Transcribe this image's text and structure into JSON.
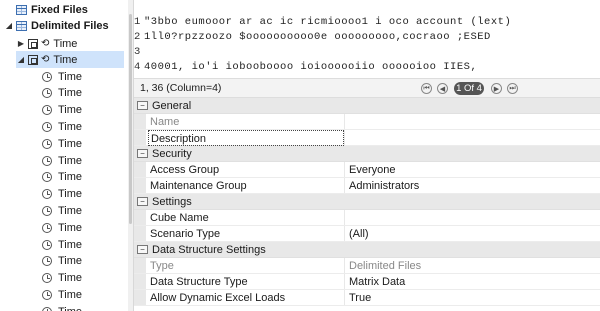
{
  "tree": {
    "items": [
      {
        "label": "Fixed Files",
        "kind": "table"
      },
      {
        "label": "Delimited Files",
        "kind": "table"
      },
      {
        "label": "Time",
        "kind": "dim"
      },
      {
        "label": "Time",
        "kind": "dim"
      },
      {
        "label": "Time"
      },
      {
        "label": "Time"
      },
      {
        "label": "Time"
      },
      {
        "label": "Time"
      },
      {
        "label": "Time"
      },
      {
        "label": "Time"
      },
      {
        "label": "Time"
      },
      {
        "label": "Time"
      },
      {
        "label": "Time"
      },
      {
        "label": "Time"
      },
      {
        "label": "Time"
      },
      {
        "label": "Time"
      },
      {
        "label": "Time"
      },
      {
        "label": "Time"
      },
      {
        "label": "Time"
      }
    ]
  },
  "grid": {
    "lines": [
      {
        "num": "1",
        "text": "\"3bbo eumooor ar ac ic ricmioooo1 i oco account (lext)"
      },
      {
        "num": "2",
        "text": "1ll0?rpzzoozo  $oooooooooo0e ooooooooo,cocraoo ;ESED"
      },
      {
        "num": "3",
        "text": ""
      },
      {
        "num": "4",
        "text": "40001,  io'i iobooboooo  ioioooooiio oooooioo  IIES,"
      }
    ]
  },
  "nav": {
    "position": "1, 36  (Column=4)",
    "page": "1 Of 4"
  },
  "props": {
    "general": "General",
    "name_label": "Name",
    "name_value": "",
    "description_label": "Description",
    "description_value": "",
    "security": "Security",
    "access_group_label": "Access Group",
    "access_group_value": "Everyone",
    "maintenance_group_label": "Maintenance Group",
    "maintenance_group_value": "Administrators",
    "settings": "Settings",
    "cube_name_label": "Cube Name",
    "cube_name_value": "",
    "scenario_type_label": "Scenario Type",
    "scenario_type_value": "(All)",
    "dss": "Data Structure Settings",
    "type_label": "Type",
    "type_value": "Delimited Files",
    "dst_label": "Data Structure Type",
    "dst_value": "Matrix Data",
    "adel_label": "Allow Dynamic Excel Loads",
    "adel_value": "True"
  }
}
